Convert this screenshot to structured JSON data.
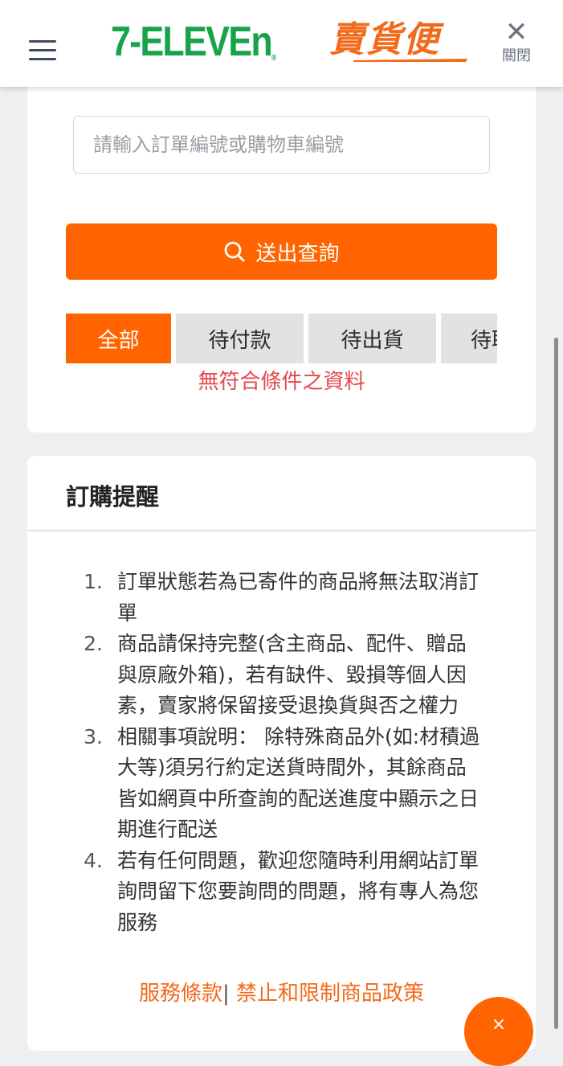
{
  "header": {
    "brand_primary": "7-ELEVEn",
    "brand_registered": "®",
    "brand_secondary": "賣貨便",
    "close_label": "關閉",
    "close_icon": "close-icon",
    "menu_icon": "hamburger-menu-icon"
  },
  "search": {
    "placeholder": "請輸入訂單編號或購物車編號",
    "value": "",
    "submit_label": "送出查詢",
    "submit_icon": "search-icon"
  },
  "tabs": [
    {
      "label": "全部",
      "active": true
    },
    {
      "label": "待付款",
      "active": false
    },
    {
      "label": "待出貨",
      "active": false
    },
    {
      "label": "待取",
      "active": false
    }
  ],
  "empty_message": "無符合條件之資料",
  "reminder": {
    "title": "訂購提醒",
    "items": [
      {
        "num": "1.",
        "text": "訂單狀態若為已寄件的商品將無法取消訂單"
      },
      {
        "num": "2.",
        "text": "商品請保持完整(含主商品、配件、贈品與原廠外箱)，若有缺件、毀損等個人因素，賣家將保留接受退換貨與否之權力"
      },
      {
        "num": "3.",
        "text": "相關事項說明： 除特殊商品外(如:材積過大等)須另行約定送貨時間外，其餘商品皆如網頁中所查詢的配送進度中顯示之日期進行配送"
      },
      {
        "num": "4.",
        "text": "若有任何問題，歡迎您隨時利用網站訂單詢問留下您要詢問的問題，將有專人為您服務"
      }
    ],
    "link_terms": "服務條款",
    "link_separator": "|",
    "link_policy": "禁止和限制商品政策"
  },
  "colors": {
    "accent": "#ff6400",
    "brand_green": "#17a34a",
    "error": "#e5484d",
    "link": "#f26a1b"
  }
}
